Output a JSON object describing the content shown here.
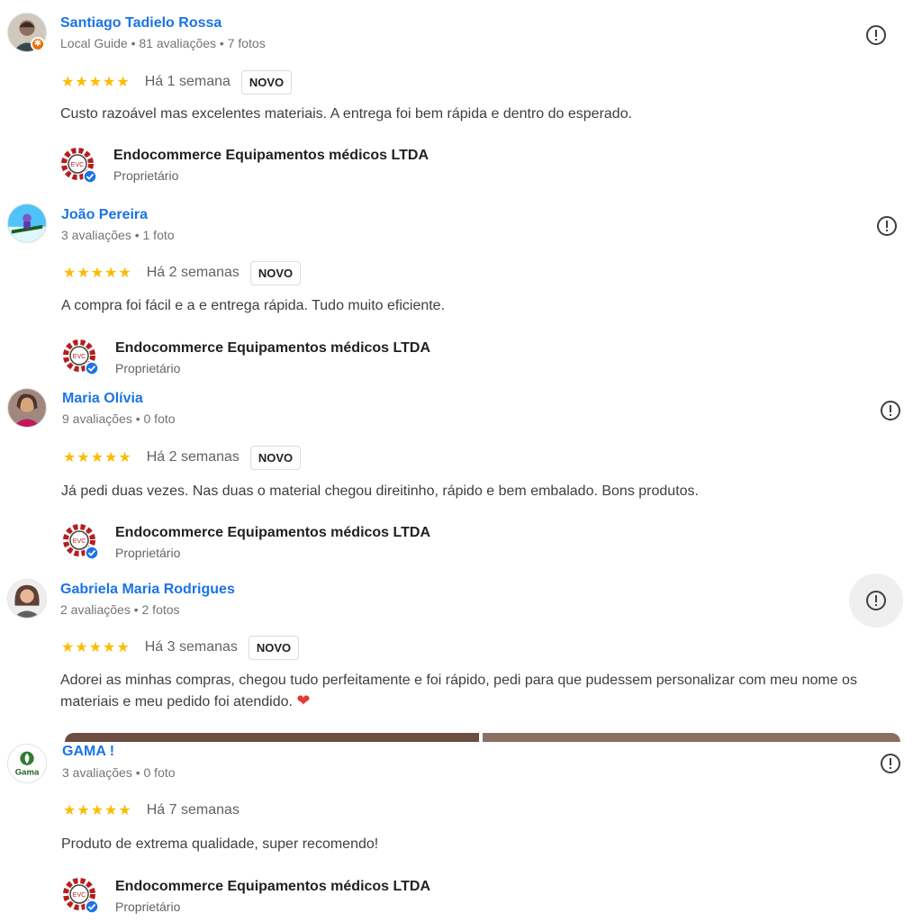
{
  "reviews": [
    {
      "name": "Santiago Tadielo Rossa",
      "meta": "Local Guide • 81 avaliações • 7 fotos",
      "stars": "★★★★★",
      "rating": 5,
      "when": "Há 1 semana",
      "badge": "NOVO",
      "text": "Custo razoável mas excelentes materiais. A entrega foi bem rápida e dentro do esperado.",
      "owner_name": "Endocommerce Equipamentos médicos LTDA",
      "owner_role": "Proprietário"
    },
    {
      "name": "João Pereira",
      "meta": "3 avaliações • 1 foto",
      "stars": "★★★★★",
      "rating": 5,
      "when": "Há 2 semanas",
      "badge": "NOVO",
      "text": "A compra foi fácil e a e entrega rápida. Tudo muito eficiente.",
      "owner_name": "Endocommerce Equipamentos médicos LTDA",
      "owner_role": "Proprietário"
    },
    {
      "name": "Maria Olívia",
      "meta": "9 avaliações • 0 foto",
      "stars": "★★★★★",
      "rating": 5,
      "when": "Há 2 semanas",
      "badge": "NOVO",
      "text": "Já pedi duas vezes. Nas duas o material chegou direitinho, rápido e bem embalado. Bons produtos.",
      "owner_name": "Endocommerce Equipamentos médicos LTDA",
      "owner_role": "Proprietário"
    },
    {
      "name": "Gabriela Maria Rodrigues",
      "meta": "2 avaliações • 2 fotos",
      "stars": "★★★★★",
      "rating": 5,
      "when": "Há 3 semanas",
      "badge": "NOVO",
      "text": "Adorei as minhas compras, chegou tudo perfeitamente e foi rápido, pedi para que pudessem personalizar com meu nome os materiais e meu pedido foi atendido.",
      "heart": "❤"
    },
    {
      "name": "GAMA !",
      "avatar_text": "Gama",
      "meta": "3 avaliações • 0 foto",
      "stars": "★★★★★",
      "rating": 5,
      "when": "Há 7 semanas",
      "text": "Produto de extrema qualidade, super recomendo!",
      "owner_name": "Endocommerce Equipamentos médicos LTDA",
      "owner_role": "Proprietário"
    }
  ],
  "logo_text": "EVC",
  "guide_badge_icon": "star-icon",
  "colors": {
    "name_blue": "#1a73e8",
    "star_yellow": "#fbbc04",
    "verified_blue": "#1a73e8",
    "logo_red": "#b71c1c"
  }
}
